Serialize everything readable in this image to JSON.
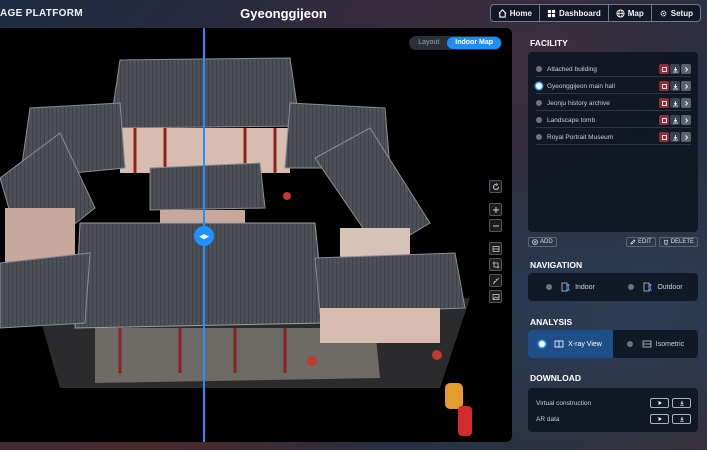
{
  "header": {
    "brand": "AGE PLATFORM",
    "title": "Gyeonggijeon",
    "nav": [
      {
        "label": "Home",
        "icon": "home-icon"
      },
      {
        "label": "Dashboard",
        "icon": "dashboard-icon"
      },
      {
        "label": "Map",
        "icon": "globe-icon"
      },
      {
        "label": "Setup",
        "icon": "gear-icon"
      }
    ]
  },
  "viewer": {
    "mode_toggle": {
      "options": [
        "Layout",
        "Indoor Map"
      ],
      "selected": "Indoor Map"
    },
    "split_handle_label": "◂▸",
    "tools": [
      "rotate-icon",
      "zoom-in-icon",
      "zoom-out-icon",
      "layers-icon",
      "crop-icon",
      "measure-icon",
      "image-icon"
    ]
  },
  "panel": {
    "facility": {
      "title": "FACILITY",
      "items": [
        {
          "label": "Attached building",
          "selected": false
        },
        {
          "label": "Gyeonggijeon main hall",
          "selected": true
        },
        {
          "label": "Jeonju history archive",
          "selected": false
        },
        {
          "label": "Landscape tomb",
          "selected": false
        },
        {
          "label": "Royal Portrait Museum",
          "selected": false
        }
      ],
      "add_label": "ADD",
      "edit_label": "EDIT",
      "delete_label": "DELETE"
    },
    "navigation": {
      "title": "NAVIGATION",
      "options": [
        {
          "label": "Indoor",
          "active": false
        },
        {
          "label": "Outdoor",
          "active": false
        }
      ]
    },
    "analysis": {
      "title": "ANALYSIS",
      "options": [
        {
          "label": "X-ray View",
          "active": true
        },
        {
          "label": "Isometric",
          "active": false
        }
      ]
    },
    "download": {
      "title": "DOWNLOAD",
      "items": [
        {
          "label": "Virtual construction"
        },
        {
          "label": "AR data"
        }
      ]
    }
  },
  "colors": {
    "accent": "#1e90ff",
    "selected_bg": "#1f4f88",
    "panel_bg": "#0c1420"
  }
}
